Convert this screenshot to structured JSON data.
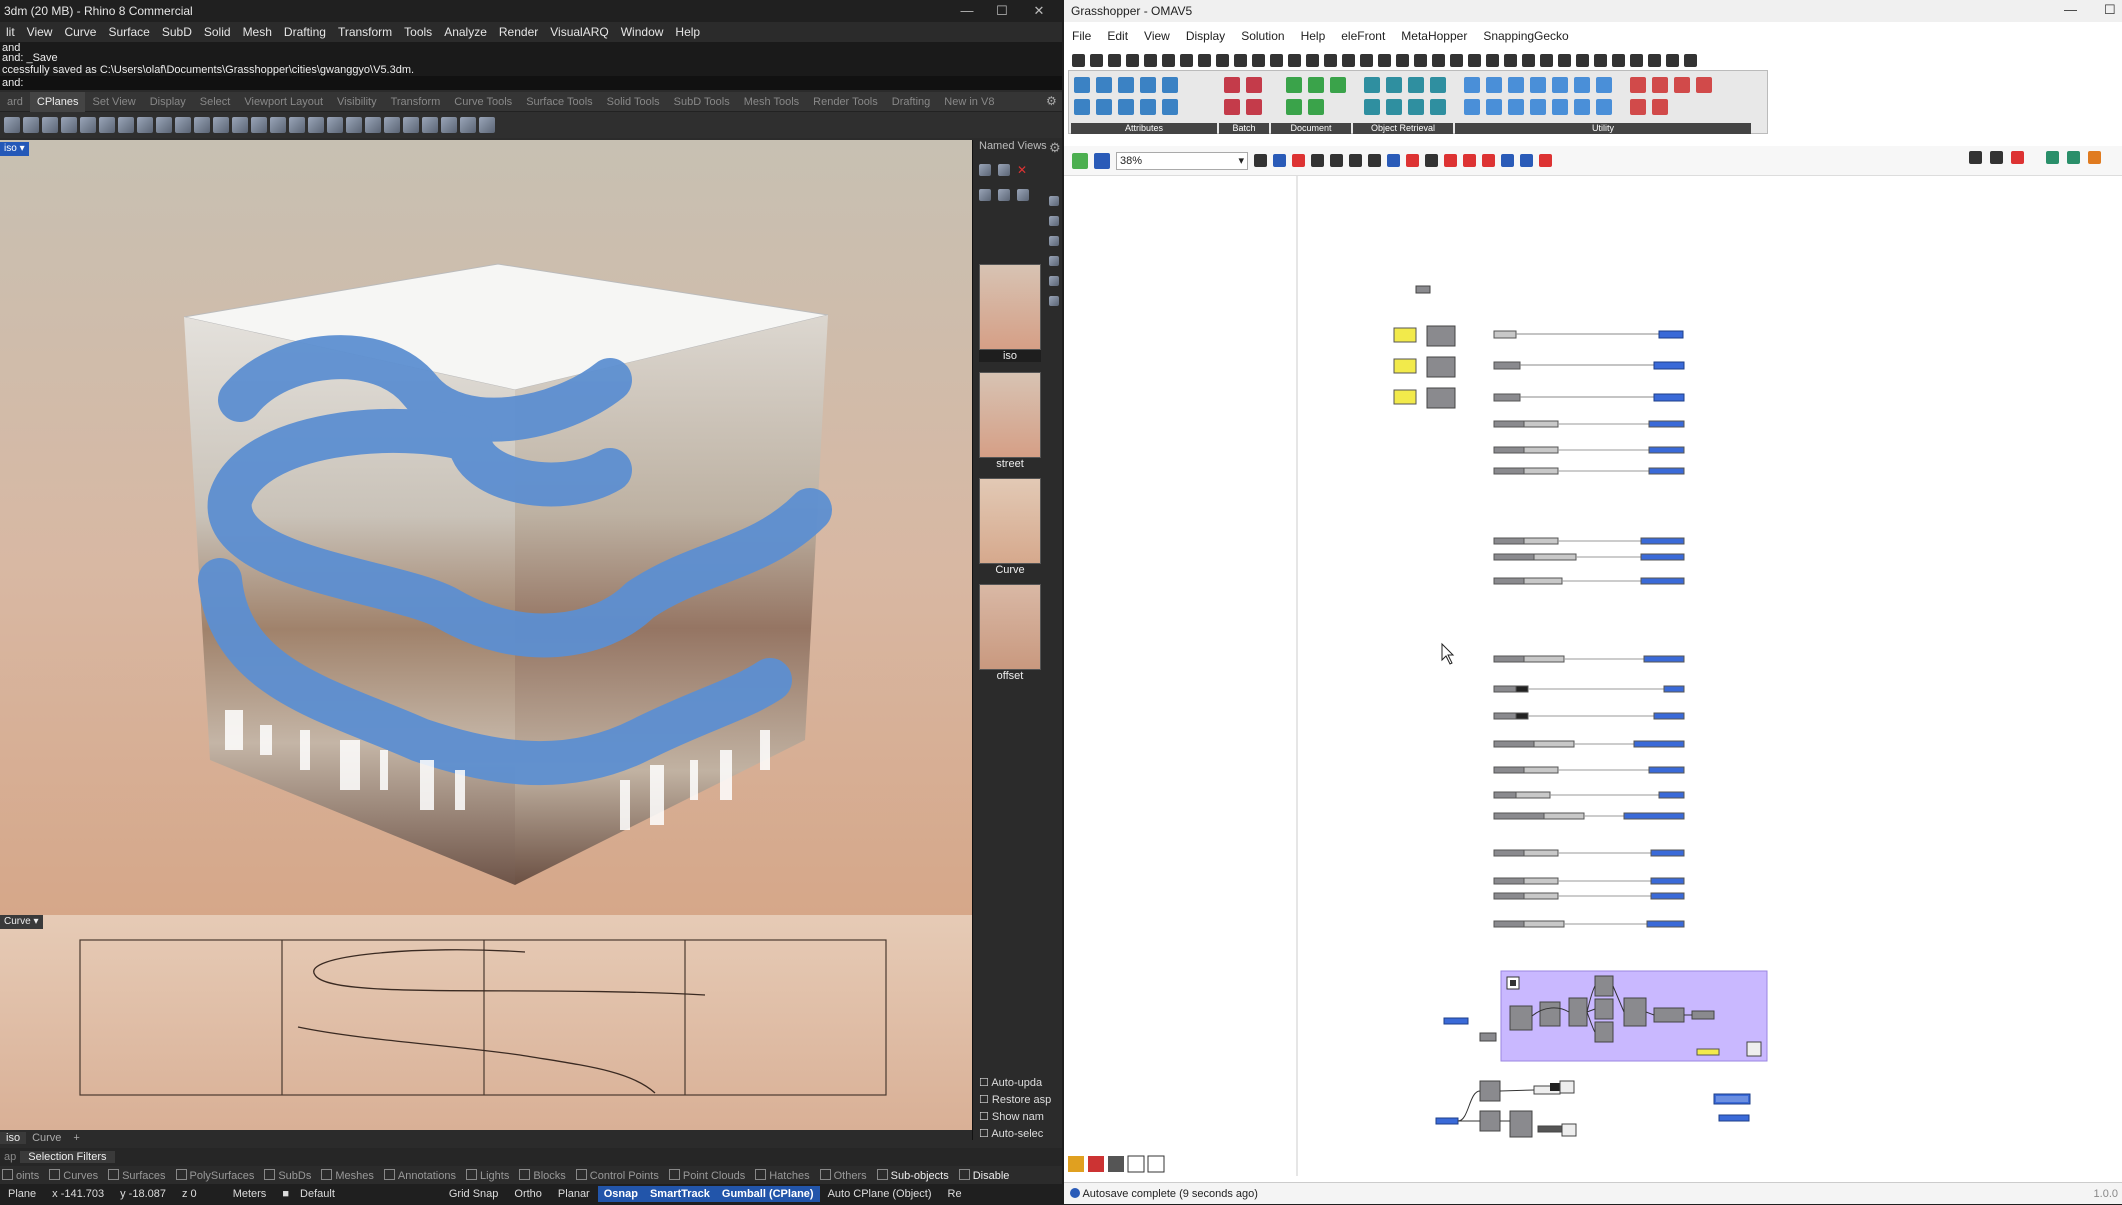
{
  "rhino": {
    "title": "3dm (20 MB) - Rhino 8 Commercial",
    "menu": [
      "lit",
      "View",
      "Curve",
      "Surface",
      "SubD",
      "Solid",
      "Mesh",
      "Drafting",
      "Transform",
      "Tools",
      "Analyze",
      "Render",
      "VisualARQ",
      "Window",
      "Help"
    ],
    "command_history": [
      "and: _Save",
      "ccessfully saved as C:\\Users\\olaf\\Documents\\Grasshopper\\cities\\gwanggyo\\V5.3dm."
    ],
    "command_prompt": "and:",
    "tabs": [
      "ard",
      "CPlanes",
      "Set View",
      "Display",
      "Select",
      "Viewport Layout",
      "Visibility",
      "Transform",
      "Curve Tools",
      "Surface Tools",
      "Solid Tools",
      "SubD Tools",
      "Mesh Tools",
      "Render Tools",
      "Drafting",
      "New in V8"
    ],
    "active_tab": "CPlanes",
    "viewport_label": "iso",
    "named_views_header": "Named Views",
    "named_views": [
      "iso",
      "street",
      "Curve",
      "offset"
    ],
    "curve_viewport_label": "Curve",
    "viewport_tabs": [
      "iso",
      "Curve",
      "+"
    ],
    "panel_checks": [
      "Auto-upda",
      "Restore asp",
      "Show nam",
      "Auto-selec"
    ],
    "selection_filters_label": "Selection Filters",
    "filters": [
      "oints",
      "Curves",
      "Surfaces",
      "PolySurfaces",
      "SubDs",
      "Meshes",
      "Annotations",
      "Lights",
      "Blocks",
      "Control Points",
      "Point Clouds",
      "Hatches",
      "Others"
    ],
    "filter_extras": [
      "Sub-objects",
      "Disable"
    ],
    "status": {
      "plane": "Plane",
      "x": "x -141.703",
      "y": "y -18.087",
      "z": "z 0",
      "units": "Meters",
      "layer": "Default",
      "toggles": [
        "Grid Snap",
        "Ortho",
        "Planar",
        "Osnap",
        "SmartTrack",
        "Gumball (CPlane)",
        "Auto CPlane (Object)",
        "Re"
      ],
      "active_toggles": [
        "Osnap",
        "SmartTrack",
        "Gumball (CPlane)"
      ]
    }
  },
  "grasshopper": {
    "title": "Grasshopper - OMAV5",
    "menu": [
      "File",
      "Edit",
      "View",
      "Display",
      "Solution",
      "Help",
      "eleFront",
      "MetaHopper",
      "SnappingGecko"
    ],
    "ribbon_groups": [
      "Attributes",
      "Batch",
      "Document",
      "Object Retrieval",
      "Utility"
    ],
    "zoom": "38%",
    "status": "Autosave complete (9 seconds ago)",
    "version": "1.0.0"
  },
  "colors": {
    "accent": "#2255aa",
    "gh_group": "#c9b8ff",
    "gh_param": "#3a6ad8",
    "gh_panel": "#f2ea4b"
  }
}
